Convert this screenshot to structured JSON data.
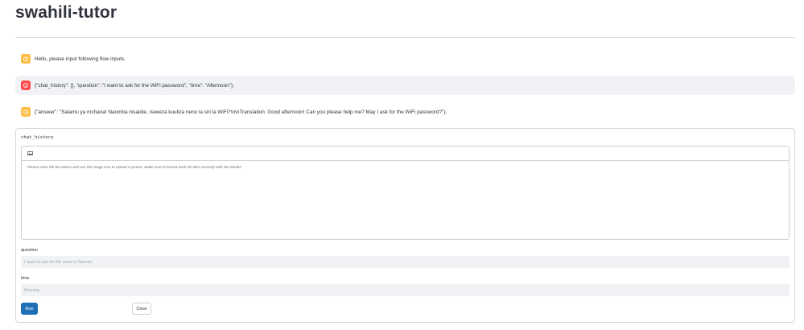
{
  "page": {
    "title": "swahili-tutor"
  },
  "messages": [
    {
      "role": "bot",
      "icon": "robot-icon",
      "text": "Hello, please input following flow inputs."
    },
    {
      "role": "user",
      "icon": "user-icon",
      "text": "{\"chat_history\": [], \"question\": \"I want to ask for the WiFi password\", \"time\": \"Afternoon\"},"
    },
    {
      "role": "bot",
      "icon": "robot-icon",
      "text": "{\"answer\": \"Salamu ya mchana! Naomba nisaidie, naweza kuuliza neno la siri la WiFi?\\n\\nTranslation: Good afternoon! Can you please help me? May I ask for the WiFi password?\"},"
    }
  ],
  "form": {
    "chat_history": {
      "label": "chat_history",
      "toolbar_icon": "image-icon",
      "placeholder": "Please enter the list values and use the image icon to upload a picture. Make sure to format each list item correctly with line breaks"
    },
    "question": {
      "label": "question",
      "placeholder": "I want to ask for the route to Nairobi"
    },
    "time": {
      "label": "time",
      "placeholder": "Morning"
    },
    "run_label": "Run",
    "clear_label": "Clear"
  },
  "colors": {
    "accent": "#1f6fb6",
    "bot_avatar": "#ffbd45",
    "user_avatar": "#ff4b4b",
    "shaded_bg": "#f0f2f6"
  }
}
